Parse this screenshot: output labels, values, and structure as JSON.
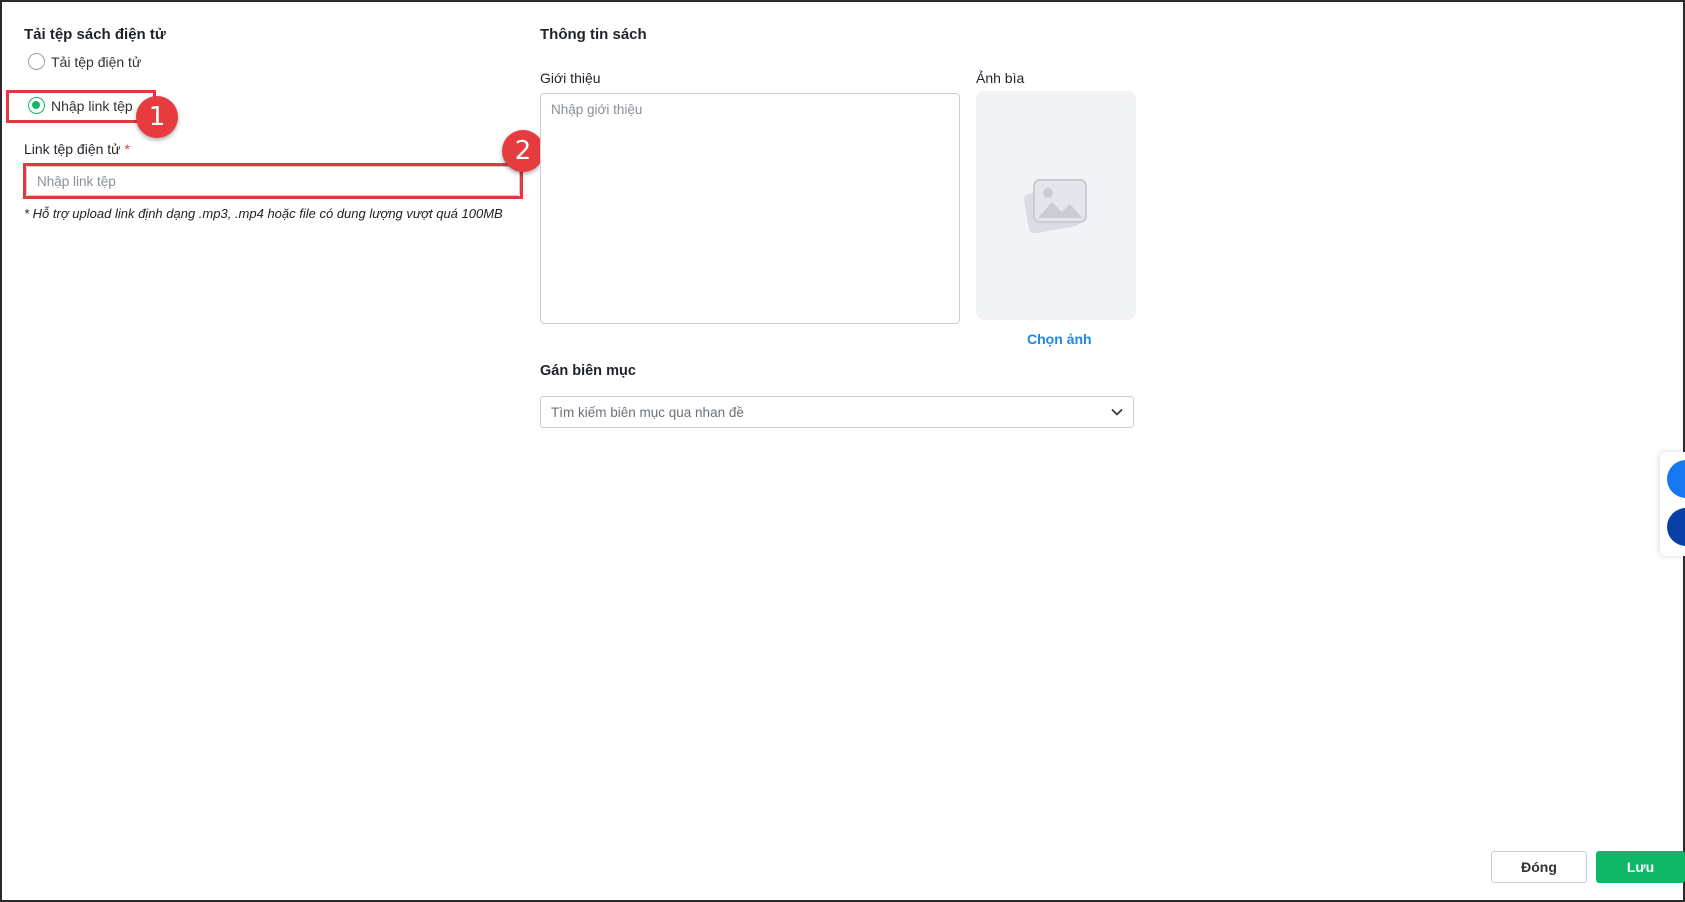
{
  "upload": {
    "section_title": "Tải tệp sách điện tử",
    "radio_upload_label": "Tải tệp điện tử",
    "radio_link_label": "Nhập link tệp",
    "link_field_label": "Link tệp điện tử",
    "required_mark": "*",
    "link_placeholder": "Nhập link tệp",
    "hint": "* Hỗ trợ upload link định dạng .mp3, .mp4 hoặc file có dung lượng vượt quá 100MB"
  },
  "annotations": {
    "step1": "1",
    "step2": "2"
  },
  "book_info": {
    "section_title": "Thông tin sách",
    "intro_label": "Giới thiệu",
    "intro_placeholder": "Nhập giới thiệu",
    "cover_label": "Ảnh bìa",
    "choose_image_label": "Chọn ảnh",
    "catalog_title": "Gán biên mục",
    "catalog_placeholder": "Tìm kiếm biên mục qua nhan đề"
  },
  "footer": {
    "close_label": "Đóng",
    "save_label": "Lưu"
  },
  "colors": {
    "accent_green": "#0fb868",
    "annotation_red": "#e0393e",
    "link_blue": "#1e88e5"
  }
}
